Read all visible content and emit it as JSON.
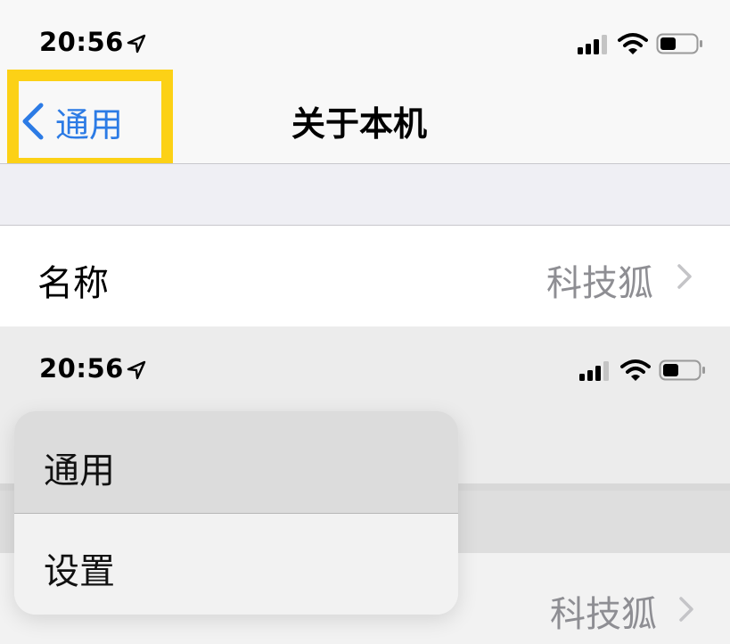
{
  "top": {
    "status_bar": {
      "time": "20:56"
    },
    "nav": {
      "back_label": "通用",
      "title": "关于本机"
    },
    "row": {
      "label": "名称",
      "value": "科技狐"
    }
  },
  "bottom": {
    "status_bar": {
      "time": "20:56"
    },
    "menu": {
      "items": [
        {
          "label": "通用"
        },
        {
          "label": "设置"
        }
      ]
    },
    "background_row": {
      "value": "科技狐"
    }
  },
  "icons": {
    "location": "location-arrow-icon",
    "signal": "cellular-signal-icon",
    "wifi": "wifi-icon",
    "battery": "battery-icon",
    "back": "chevron-left-icon",
    "disclosure": "chevron-right-icon"
  },
  "colors": {
    "accent": "#2c7be5",
    "highlight": "#fcd116",
    "secondary_text": "#8e8e93"
  }
}
